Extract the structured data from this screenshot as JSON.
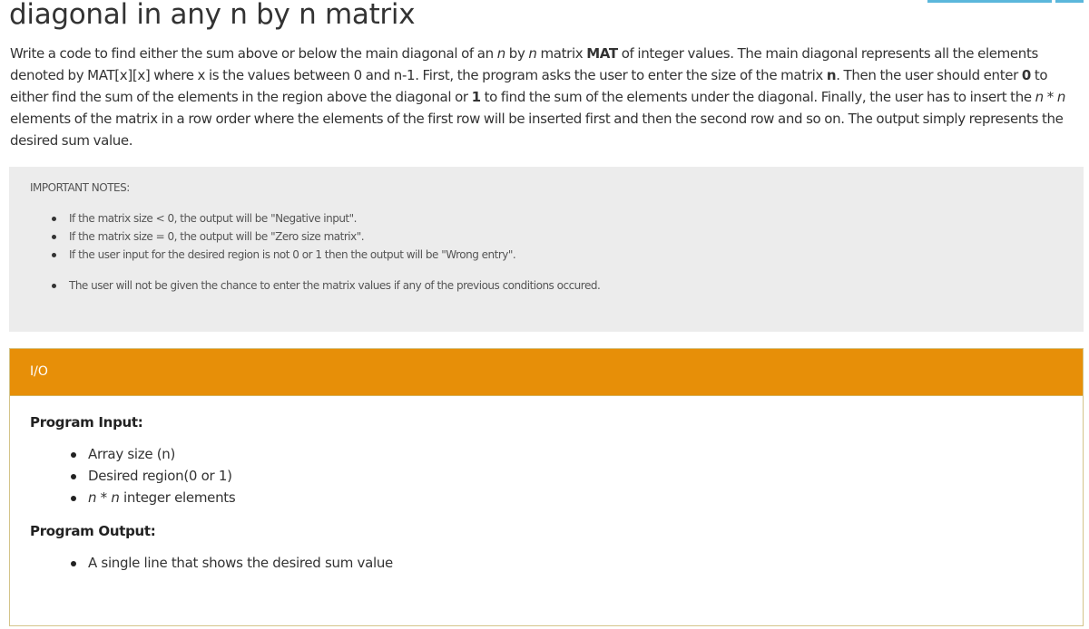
{
  "page": {
    "title": "diagonal in any n by n matrix",
    "top_buttons": [
      "",
      ""
    ],
    "accent_blue": "#5bb7db"
  },
  "description": {
    "p1": "Write a code to find either the sum above or below the main diagonal of an ",
    "n1": "n",
    "p2": " by ",
    "n2": "n",
    "p3": " matrix ",
    "mat": "MAT",
    "p4": " of integer values. The main diagonal represents all the elements denoted by MAT[x][x] where x is the values between 0 and n-1. First, the program asks the user to enter the size of the matrix ",
    "nbold": "n",
    "p5": ". Then the user should enter ",
    "zero": "0",
    "p6": " to either find the sum of the elements in the region above the diagonal or ",
    "one": "1",
    "p7": " to find the sum of the elements under the diagonal. Finally, the user has to insert the ",
    "n3": "n",
    "p8": " * ",
    "n4": "n",
    "p9": " elements of the matrix in a row order where the elements of the first row will be inserted first and then the second row and so on. The output simply represents the desired sum value."
  },
  "notes": {
    "heading": "IMPORTANT NOTES:",
    "items": [
      "If the matrix size < 0, the output will be \"Negative input\".",
      "If the matrix size = 0, the output will be \"Zero size matrix\".",
      "If the user input for the desired region is not 0 or 1 then the output will be \"Wrong entry\".",
      "The user will not be given the chance to enter the matrix values if any of the previous conditions occured."
    ],
    "background": "#ececec"
  },
  "io": {
    "header": "I/O",
    "header_color": "#e78f08",
    "input_heading": "Program Input:",
    "input_items": [
      "Array size (n)",
      "Desired region(0 or 1)"
    ],
    "input_item3": {
      "n1": "n",
      "mid": " * ",
      "n2": "n",
      "rest": " integer elements"
    },
    "output_heading": "Program Output:",
    "output_items": [
      "A single line that shows the desired sum value"
    ]
  }
}
